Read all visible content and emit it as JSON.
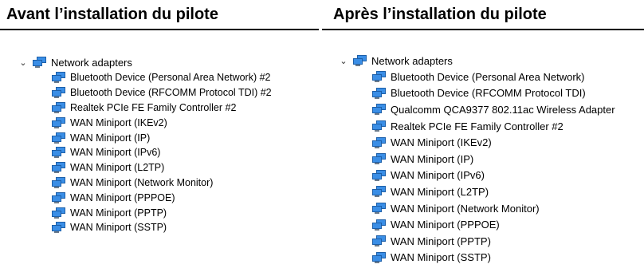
{
  "before": {
    "title": "Avant l’installation du pilote",
    "category": {
      "icon": "network-adapter-icon",
      "expander_icon": "chevron-down-icon",
      "label": "Network adapters"
    },
    "items": [
      "Bluetooth Device (Personal Area Network) #2",
      "Bluetooth Device (RFCOMM Protocol TDI) #2",
      "Realtek PCIe FE Family Controller #2",
      "WAN Miniport (IKEv2)",
      "WAN Miniport (IP)",
      "WAN Miniport (IPv6)",
      "WAN Miniport (L2TP)",
      "WAN Miniport (Network Monitor)",
      "WAN Miniport (PPPOE)",
      "WAN Miniport (PPTP)",
      "WAN Miniport (SSTP)"
    ]
  },
  "after": {
    "title": "Après l’installation du pilote",
    "category": {
      "icon": "network-adapter-icon",
      "expander_icon": "chevron-down-icon",
      "label": "Network adapters"
    },
    "items": [
      "Bluetooth Device (Personal Area Network)",
      "Bluetooth Device (RFCOMM Protocol TDI)",
      "Qualcomm QCA9377 802.11ac Wireless Adapter",
      "Realtek PCIe FE Family Controller #2",
      "WAN Miniport (IKEv2)",
      "WAN Miniport (IP)",
      "WAN Miniport (IPv6)",
      "WAN Miniport (L2TP)",
      "WAN Miniport (Network Monitor)",
      "WAN Miniport (PPPOE)",
      "WAN Miniport (PPTP)",
      "WAN Miniport (SSTP)"
    ]
  },
  "colors": {
    "monitor_screen": "#3a8ee6",
    "monitor_frame": "#1d5fa8",
    "monitor_base": "#6b7b8c"
  }
}
